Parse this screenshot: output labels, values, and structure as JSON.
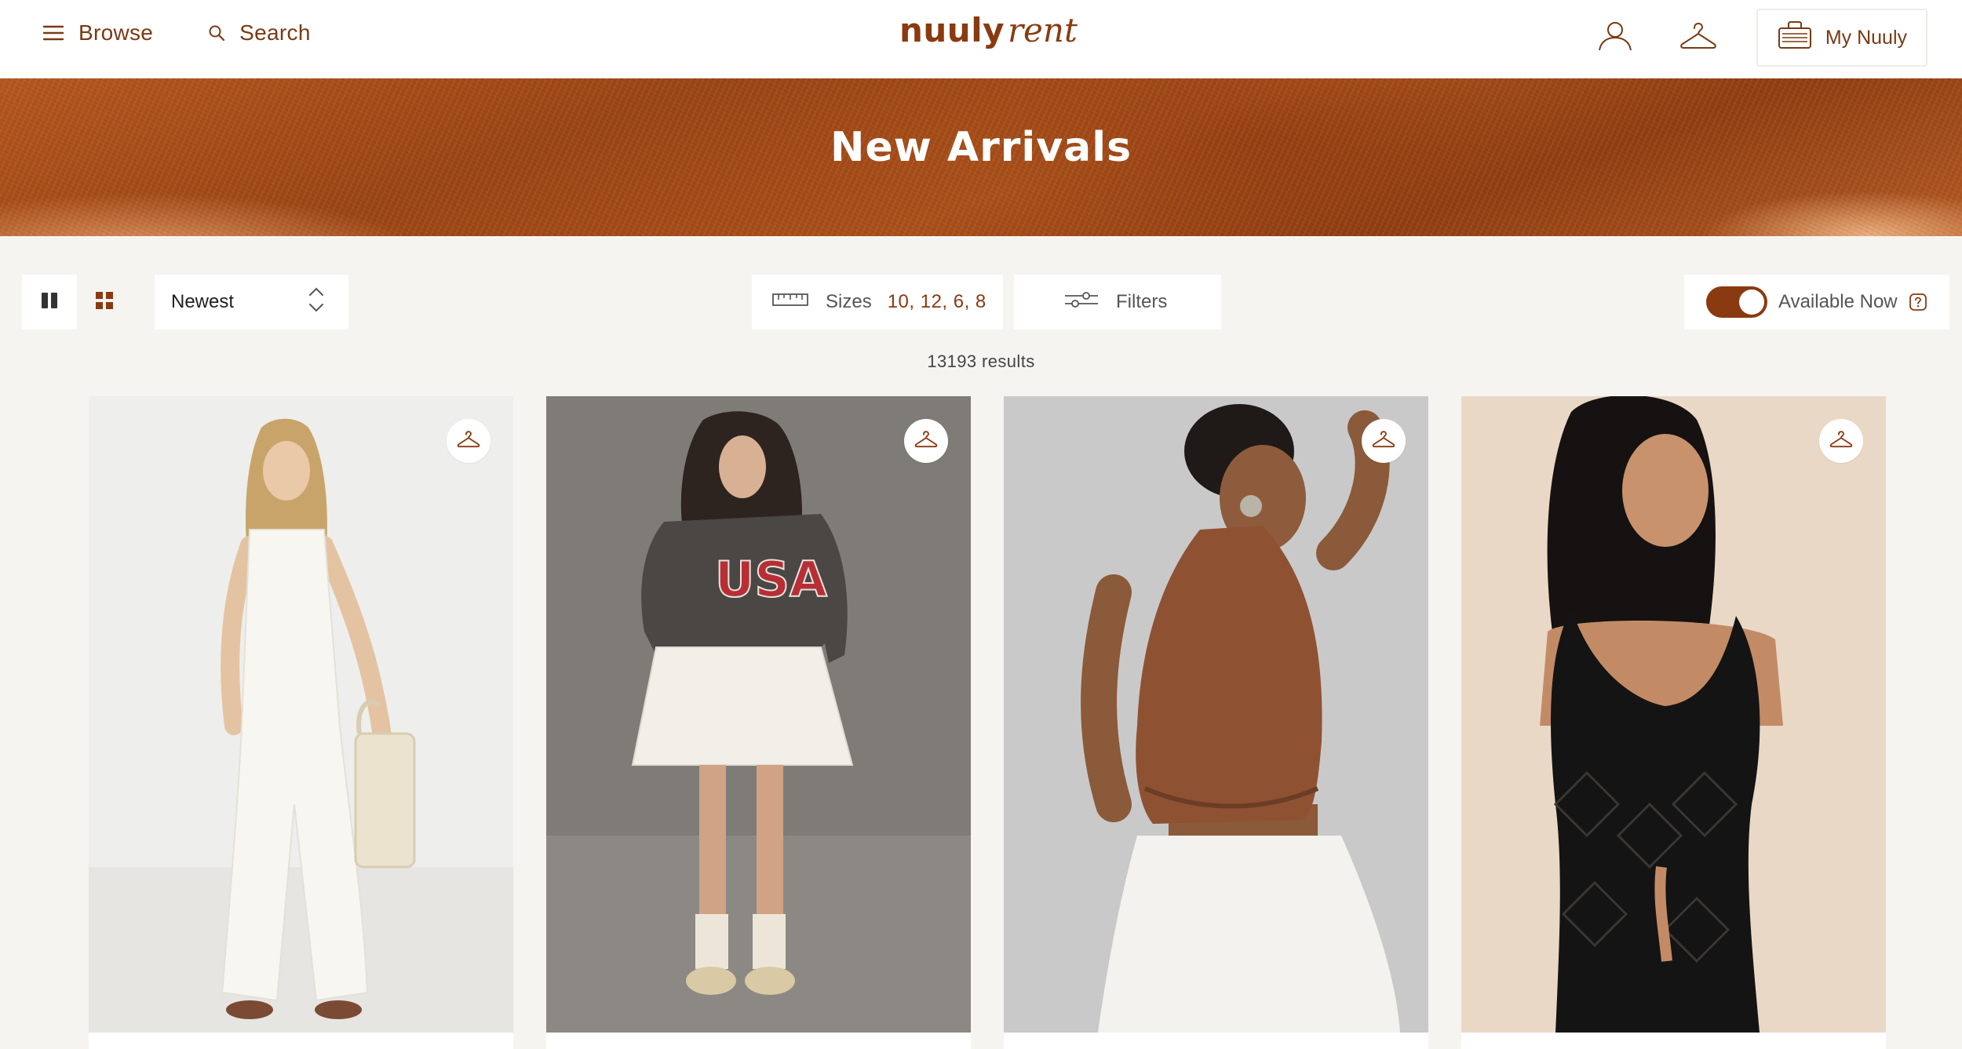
{
  "header": {
    "browse_label": "Browse",
    "search_label": "Search",
    "logo_main": "nuuly",
    "logo_sub": "rent",
    "my_nuuly_label": "My Nuuly"
  },
  "banner": {
    "title": "New Arrivals"
  },
  "toolbar": {
    "sort_value": "Newest",
    "sizes_label": "Sizes",
    "sizes_values": "10, 12, 6, 8",
    "filters_label": "Filters",
    "available_now_label": "Available Now",
    "available_now_on": true
  },
  "results_text": "13193 results",
  "colors": {
    "brand": "#8a3a10",
    "background": "#f6f4f0",
    "card": "#ffffff"
  },
  "products": [
    {
      "description": "white jumpsuit",
      "icon": "hanger-icon"
    },
    {
      "description": "USA sweatshirt with white skirt",
      "icon": "hanger-icon"
    },
    {
      "description": "brown halter top",
      "icon": "hanger-icon"
    },
    {
      "description": "black crochet vest",
      "icon": "hanger-icon"
    }
  ]
}
